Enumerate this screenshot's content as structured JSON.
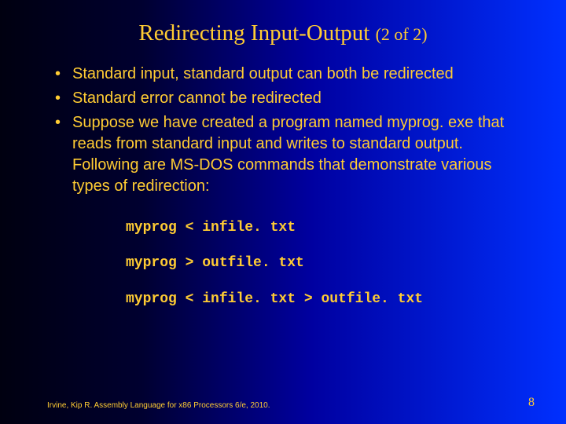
{
  "title": {
    "main": "Redirecting Input-Output",
    "sub": "(2 of 2)"
  },
  "bullets": [
    "Standard input, standard output can both be redirected",
    "Standard error cannot be redirected",
    "Suppose we have created a program named myprog. exe that reads from standard input and writes to standard output. Following are MS-DOS commands that demonstrate various types of redirection:"
  ],
  "code": [
    "myprog < infile. txt",
    "myprog > outfile. txt",
    "myprog < infile. txt > outfile. txt"
  ],
  "footer": "Irvine, Kip R. Assembly Language for x86 Processors 6/e, 2010.",
  "page": "8"
}
